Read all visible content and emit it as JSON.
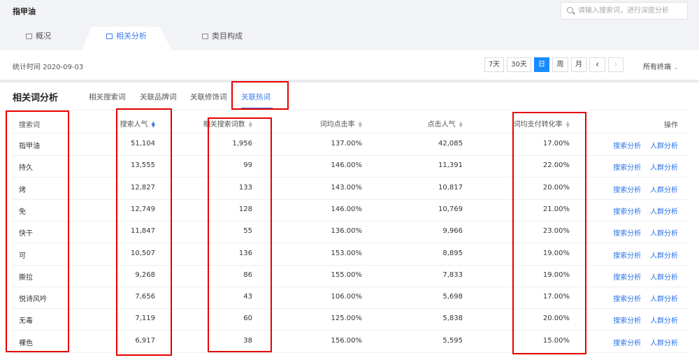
{
  "header": {
    "keyword": "指甲油",
    "search_placeholder": "请输入搜索词，进行深度分析"
  },
  "tabs": [
    {
      "label": "概况"
    },
    {
      "label": "相关分析"
    },
    {
      "label": "类目构成"
    }
  ],
  "date_label": "统计时间 2020-09-03",
  "range_buttons": [
    "7天",
    "30天",
    "日",
    "周",
    "月"
  ],
  "prev": "‹",
  "next": "›",
  "terminal": "所有终端",
  "section": {
    "title": "相关词分析",
    "subtabs": [
      "相关搜索词",
      "关联品牌词",
      "关联修饰词",
      "关联热词"
    ]
  },
  "columns": [
    "搜索词",
    "搜索人气",
    "相关搜索词数",
    "词均点击率",
    "点击人气",
    "词均支付转化率",
    "操作"
  ],
  "actions": [
    "搜索分析",
    "人群分析"
  ],
  "rows": [
    [
      "指甲油",
      "51,104",
      "1,956",
      "137.00%",
      "42,085",
      "17.00%"
    ],
    [
      "持久",
      "13,555",
      "99",
      "146.00%",
      "11,391",
      "22.00%"
    ],
    [
      "烤",
      "12,827",
      "133",
      "143.00%",
      "10,817",
      "20.00%"
    ],
    [
      "免",
      "12,749",
      "128",
      "146.00%",
      "10,769",
      "21.00%"
    ],
    [
      "快干",
      "11,847",
      "55",
      "136.00%",
      "9,966",
      "23.00%"
    ],
    [
      "可",
      "10,507",
      "136",
      "153.00%",
      "8,895",
      "19.00%"
    ],
    [
      "撕拉",
      "9,268",
      "86",
      "155.00%",
      "7,833",
      "19.00%"
    ],
    [
      "悦诗风吟",
      "7,656",
      "43",
      "106.00%",
      "5,698",
      "17.00%"
    ],
    [
      "无毒",
      "7,119",
      "60",
      "125.00%",
      "5,838",
      "20.00%"
    ],
    [
      "裸色",
      "6,917",
      "38",
      "156.00%",
      "5,595",
      "15.00%"
    ]
  ]
}
